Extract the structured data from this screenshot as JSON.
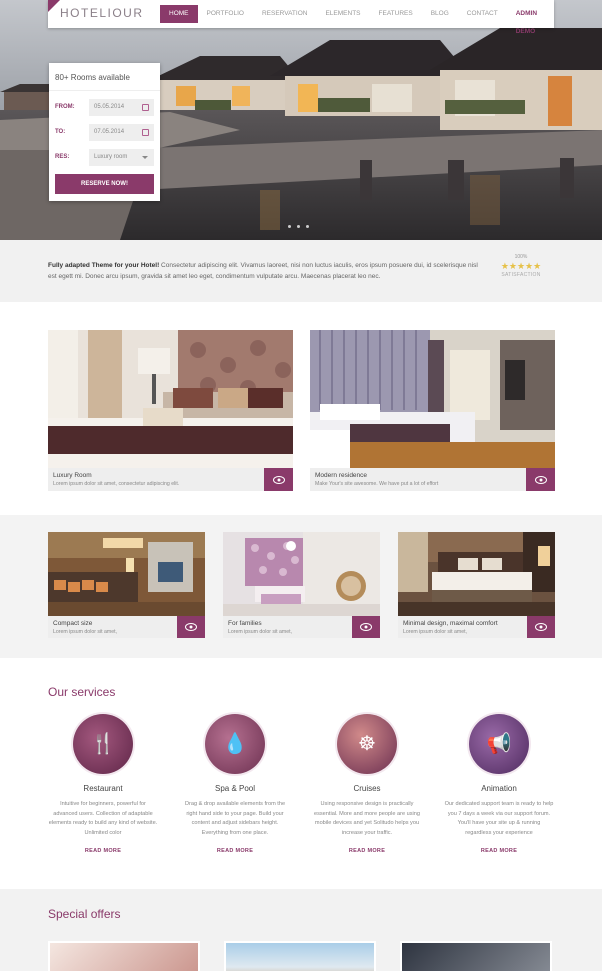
{
  "nav": {
    "logo": "HOTELIOUR",
    "items": [
      "HOME",
      "PORTFOLIO",
      "RESERVATION",
      "ELEMENTS",
      "FEATURES",
      "BLOG",
      "CONTACT",
      "ADMIN DEMO"
    ],
    "active": "HOME"
  },
  "booking": {
    "title": "80+ Rooms available",
    "from_label": "FROM:",
    "from_value": "05.05.2014",
    "to_label": "TO:",
    "to_value": "07.05.2014",
    "res_label": "RES:",
    "res_value": "Luxury room",
    "button": "RESERVE NOW!"
  },
  "intro": {
    "bold": "Fully adapted Theme for your Hotel!",
    "text": " Consectetur adipiscing elit. Vivamus laoreet, nisi non luctus iaculis, eros ipsum posuere dui, id scelerisque nisl est egett mi. Donec arcu ipsum, gravida sit amet leo eget, condimentum vulputate arcu. Maecenas placerat leo nec.",
    "rating_pct": "100%",
    "stars": "★★★★★",
    "rating_label": "SATISFACTION"
  },
  "rooms_large": [
    {
      "title": "Luxury Room",
      "desc": "Lorem ipsum dolor sit amet, consectetur adipiscing elit."
    },
    {
      "title": "Modern residence",
      "desc": "Make Your's site awesome. We have put a lot of effort"
    }
  ],
  "rooms_small": [
    {
      "title": "Compact size",
      "desc": "Lorem ipsum dolor sit amet,"
    },
    {
      "title": "For families",
      "desc": "Lorem ipsum dolor sit amet,"
    },
    {
      "title": "Minimal design, maximal comfort",
      "desc": "Lorem ipsum dolor sit amet,"
    }
  ],
  "services": {
    "title": "Our services",
    "items": [
      {
        "name": "Restaurant",
        "icon": "cutlery-icon",
        "desc": "Intuitive for beginners, powerful for advanced users. Collection of adaptable elements ready to build any kind of website. Unlimited color",
        "link": "READ MORE"
      },
      {
        "name": "Spa & Pool",
        "icon": "water-drop-icon",
        "desc": "Drag & drop available elements from the right hand side to your page. Build your content and adjust sidebars height. Everything from one place.",
        "link": "READ MORE"
      },
      {
        "name": "Cruises",
        "icon": "ship-wheel-icon",
        "desc": "Using responsive design is practically essential. More and more people are using mobile devices and yet Solitudo helps you increase your traffic.",
        "link": "READ MORE"
      },
      {
        "name": "Animation",
        "icon": "megaphone-icon",
        "desc": "Our dedicated support team is ready to help you 7 days a week via our support forum. You'll have your site up & running regardless your experience",
        "link": "READ MORE"
      }
    ]
  },
  "offers": {
    "title": "Special offers"
  },
  "colors": {
    "accent": "#8a3a6a",
    "star": "#e6c148"
  }
}
